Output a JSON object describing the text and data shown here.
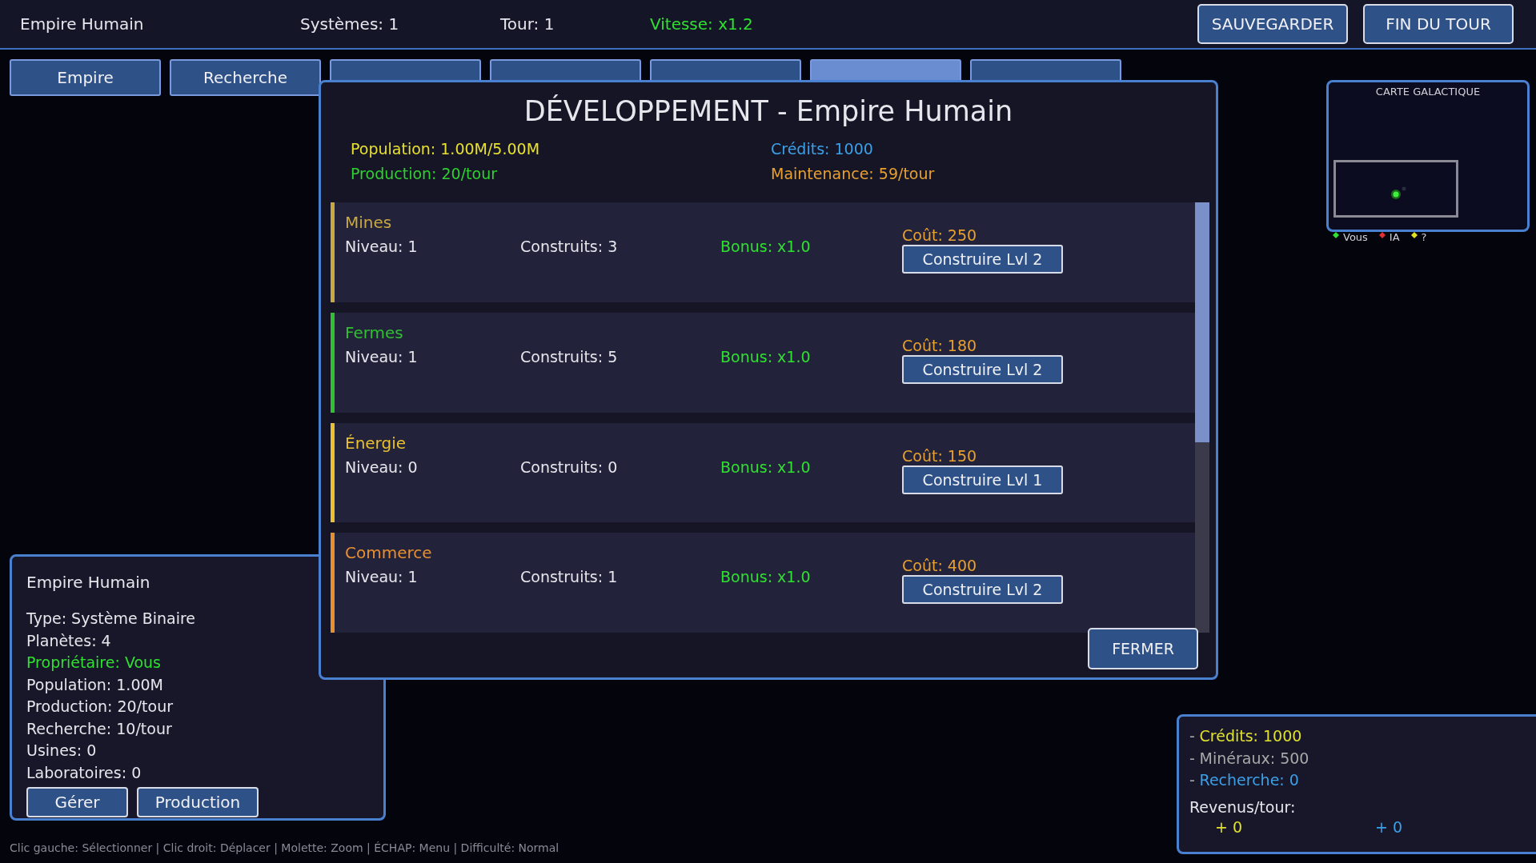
{
  "top_bar": {
    "title": "Empire Humain",
    "systems": "Systèmes: 1",
    "turn": "Tour: 1",
    "speed": "Vitesse: x1.2",
    "buttons": [
      "SAUVEGARDER",
      "FIN DU TOUR"
    ]
  },
  "tabs": [
    {
      "label": "Empire",
      "selected": false
    },
    {
      "label": "Recherche",
      "selected": false
    },
    {
      "selected": false
    },
    {
      "selected": false
    },
    {
      "selected": false
    },
    {
      "selected": true
    },
    {
      "selected": false
    }
  ],
  "modal": {
    "title": "DÉVELOPPEMENT - Empire Humain",
    "stats": [
      {
        "text": "Population: 1.00M/5.00M",
        "color": "#e8e030"
      },
      {
        "text": "Crédits: 1000",
        "color": "#3ca0e8"
      },
      {
        "text": "Production: 20/tour",
        "color": "#30d030"
      },
      {
        "text": "Maintenance: 59/tour",
        "color": "#e8a030"
      }
    ],
    "buildings": [
      {
        "name": "Mines",
        "color": "#c8a840",
        "level": "Niveau: 1",
        "built": "Construits: 3",
        "bonus": "Bonus: x1.0",
        "cost": "Coût: 250",
        "action": "Construire Lvl 2"
      },
      {
        "name": "Fermes",
        "color": "#30c030",
        "level": "Niveau: 1",
        "built": "Construits: 5",
        "bonus": "Bonus: x1.0",
        "cost": "Coût: 180",
        "action": "Construire Lvl 2"
      },
      {
        "name": "Énergie",
        "color": "#e8c030",
        "level": "Niveau: 0",
        "built": "Construits: 0",
        "bonus": "Bonus: x1.0",
        "cost": "Coût: 150",
        "action": "Construire Lvl 1"
      },
      {
        "name": "Commerce",
        "color": "#e89030",
        "level": "Niveau: 1",
        "built": "Construits: 1",
        "bonus": "Bonus: x1.0",
        "cost": "Coût: 400",
        "action": "Construire Lvl 2"
      }
    ],
    "close": "FERMER"
  },
  "minimap": {
    "title": "CARTE GALACTIQUE",
    "legend": [
      {
        "label": "Vous",
        "color": "#30e030"
      },
      {
        "label": "IA",
        "color": "#e03030"
      },
      {
        "label": "?",
        "color": "#e0e020"
      }
    ]
  },
  "system_panel": {
    "title": "Empire Humain",
    "lines": [
      {
        "text": "Type: Système Binaire",
        "highlight": false
      },
      {
        "text": "Planètes: 4",
        "highlight": false
      },
      {
        "text": "Propriétaire: Vous",
        "highlight": true
      },
      {
        "text": "Population: 1.00M",
        "highlight": false
      },
      {
        "text": "Production: 20/tour",
        "highlight": false
      },
      {
        "text": "Recherche: 10/tour",
        "highlight": false
      },
      {
        "text": "Usines: 0",
        "highlight": false
      },
      {
        "text": "Laboratoires: 0",
        "highlight": false
      }
    ],
    "buttons": [
      "Gérer",
      "Production"
    ]
  },
  "resources": {
    "lines": [
      {
        "prefix": "-",
        "text": "Crédits: 1000",
        "color": "#e0e030"
      },
      {
        "prefix": "-",
        "text": "Minéraux: 500",
        "color": "#a8a8a8"
      },
      {
        "prefix": "-",
        "text": "Recherche: 0",
        "color": "#3ca0e8"
      }
    ],
    "income_label": "Revenus/tour:",
    "income": [
      {
        "text": "+ 0",
        "color": "#e0e030"
      },
      {
        "text": "+ 0",
        "color": "#3ca0e8"
      }
    ]
  },
  "status_bar": "Clic gauche: Sélectionner | Clic droit: Déplacer | Molette: Zoom | ÉCHAP: Menu | Difficulté: Normal"
}
